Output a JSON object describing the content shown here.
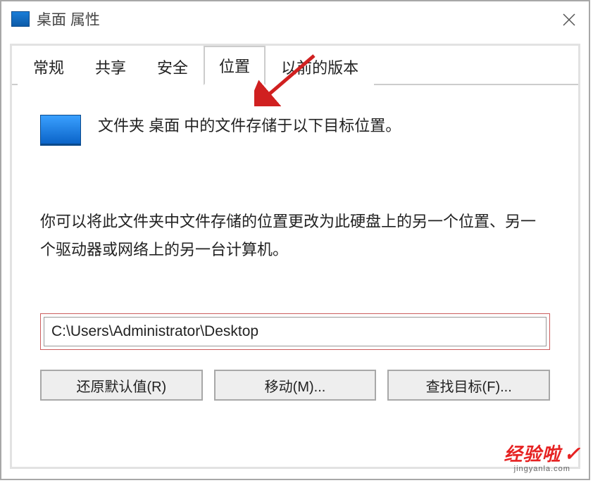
{
  "window": {
    "title": "桌面 属性"
  },
  "tabs": {
    "items": [
      "常规",
      "共享",
      "安全",
      "位置",
      "以前的版本"
    ],
    "active_index": 3
  },
  "content": {
    "description": "文件夹 桌面 中的文件存储于以下目标位置。",
    "help": "你可以将此文件夹中文件存储的位置更改为此硬盘上的另一个位置、另一个驱动器或网络上的另一台计算机。",
    "path": "C:\\Users\\Administrator\\Desktop"
  },
  "buttons": {
    "restore": "还原默认值(R)",
    "move": "移动(M)...",
    "find": "查找目标(F)..."
  },
  "watermark": {
    "main": "经验啦",
    "url": "jingyanla.com"
  }
}
